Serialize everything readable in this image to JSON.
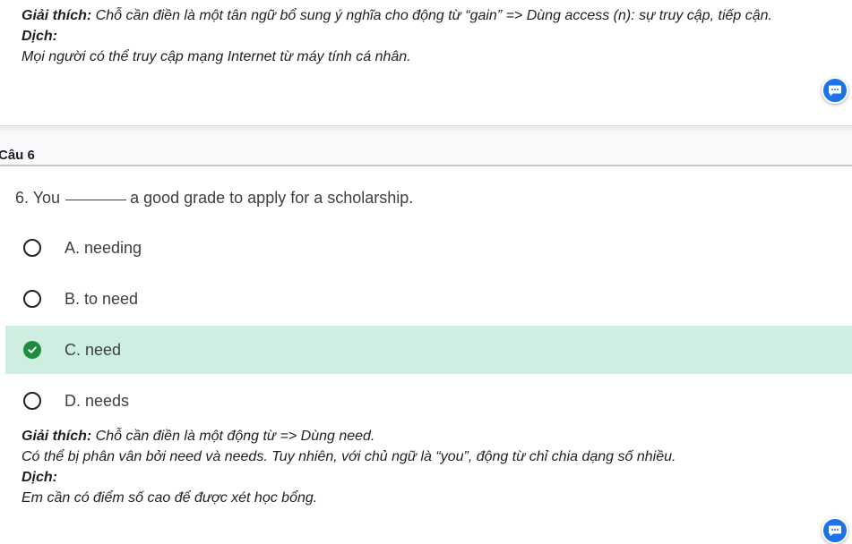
{
  "previous_explanation": {
    "explain_label": "Giải thích:",
    "explain_text": " Chỗ cần điền là một tân ngữ bổ sung ý nghĩa cho động từ “gain” => Dùng access (n): sự truy cập, tiếp cận.",
    "translate_label": "Dịch:",
    "translate_text": "Mọi người có thể truy cập mạng Internet từ máy tính cá nhân."
  },
  "question_header": {
    "label": "Câu 6"
  },
  "question": {
    "before_blank": "6. You",
    "after_blank": "a good grade to apply for a scholarship."
  },
  "options": [
    {
      "label": "A. needing",
      "state": "unselected"
    },
    {
      "label": "B. to need",
      "state": "unselected"
    },
    {
      "label": "C. need",
      "state": "correct"
    },
    {
      "label": "D. needs",
      "state": "unselected"
    }
  ],
  "explanation": {
    "explain_label": "Giải thích:",
    "explain_text": " Chỗ cần điền là một động từ => Dùng need.",
    "extra_text": "Có thể bị phân vân bởi need và needs. Tuy nhiên, với chủ ngữ là “you”, động từ chỉ chia dạng số nhiều.",
    "translate_label": "Dịch:",
    "translate_text": "Em cần có điểm số cao để được xét học bổng."
  },
  "icons": {
    "chat": "chat-bubble-icon",
    "radio": "radio-empty-icon",
    "check": "check-circle-icon"
  },
  "colors": {
    "correct_bg": "#ceeee2",
    "check_green": "#1e8e3e",
    "chat_blue": "#1a73e8"
  }
}
